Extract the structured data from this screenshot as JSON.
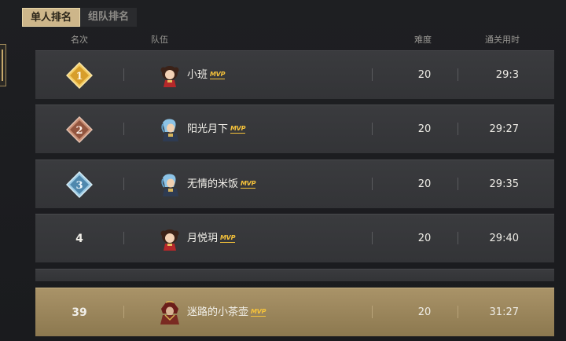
{
  "tabs": [
    {
      "label": "单人排名",
      "active": true
    },
    {
      "label": "组队排名",
      "active": false
    }
  ],
  "columns": {
    "rank": "名次",
    "team": "队伍",
    "difficulty": "难度",
    "time": "通关用时"
  },
  "mvp_label": "MVP",
  "rows": [
    {
      "rank": "1",
      "name": "小班",
      "difficulty": "20",
      "time": "29:3",
      "badge": "gold",
      "avatar": "female-warrior"
    },
    {
      "rank": "2",
      "name": "阳光月下",
      "difficulty": "20",
      "time": "29:27",
      "badge": "bronze",
      "avatar": "blue-hair-hero"
    },
    {
      "rank": "3",
      "name": "无情的米饭",
      "difficulty": "20",
      "time": "29:35",
      "badge": "silver",
      "avatar": "blue-hair-hero"
    },
    {
      "rank": "4",
      "name": "月悦玥",
      "difficulty": "20",
      "time": "29:40",
      "badge": "none",
      "avatar": "female-warrior"
    }
  ],
  "self_row": {
    "rank": "39",
    "name": "迷路的小茶壶",
    "difficulty": "20",
    "time": "31:27",
    "avatar": "armored-warrior"
  },
  "colors": {
    "gold": "#e8b84a",
    "bronze": "#a86a52",
    "silver": "#5f95b8",
    "highlight": "#a99368"
  }
}
